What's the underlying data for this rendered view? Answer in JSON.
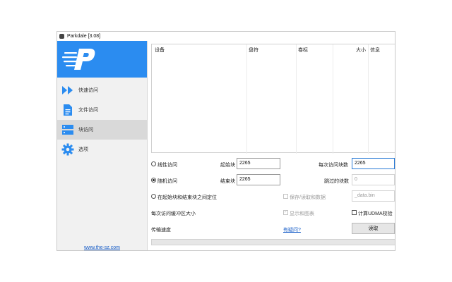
{
  "window": {
    "title": "Parkdale [3.08]"
  },
  "sidebar": {
    "items": [
      {
        "label": "快速访问",
        "icon": "fast-forward-icon"
      },
      {
        "label": "文件访问",
        "icon": "document-icon"
      },
      {
        "label": "块访问",
        "icon": "block-icon",
        "active": true
      },
      {
        "label": "选项",
        "icon": "gear-icon"
      }
    ],
    "site_link": "www.the-sz.com"
  },
  "table": {
    "columns": [
      "设备",
      "盘符",
      "卷标",
      "大小",
      "信息"
    ]
  },
  "form": {
    "linear_access": "线性访问",
    "random_access": "随机访问",
    "between_blocks": "在起始块和结束块之间定位",
    "start_block_label": "起始块",
    "start_block_value": "2265",
    "end_block_label": "结束块",
    "end_block_value": "2265",
    "blocks_per_access_label": "每次访问块数",
    "blocks_per_access_value": "2265",
    "skipped_blocks_label": "跳过的块数",
    "skipped_blocks_value": "0",
    "save_read_data": "保存/读取和数据",
    "file_value": "_data.bin",
    "show_chart": "显示和图表",
    "buffer_size_label": "每次访问缓冲区大小",
    "udma_check": "计算UDMA校验",
    "transfer_speed_label": "传输速度",
    "help_link": "有疑问?",
    "read_button": "读取"
  },
  "progress": {
    "fraction": 0
  },
  "colors": {
    "accent": "#2b8cf0",
    "link": "#1a5fc8"
  }
}
